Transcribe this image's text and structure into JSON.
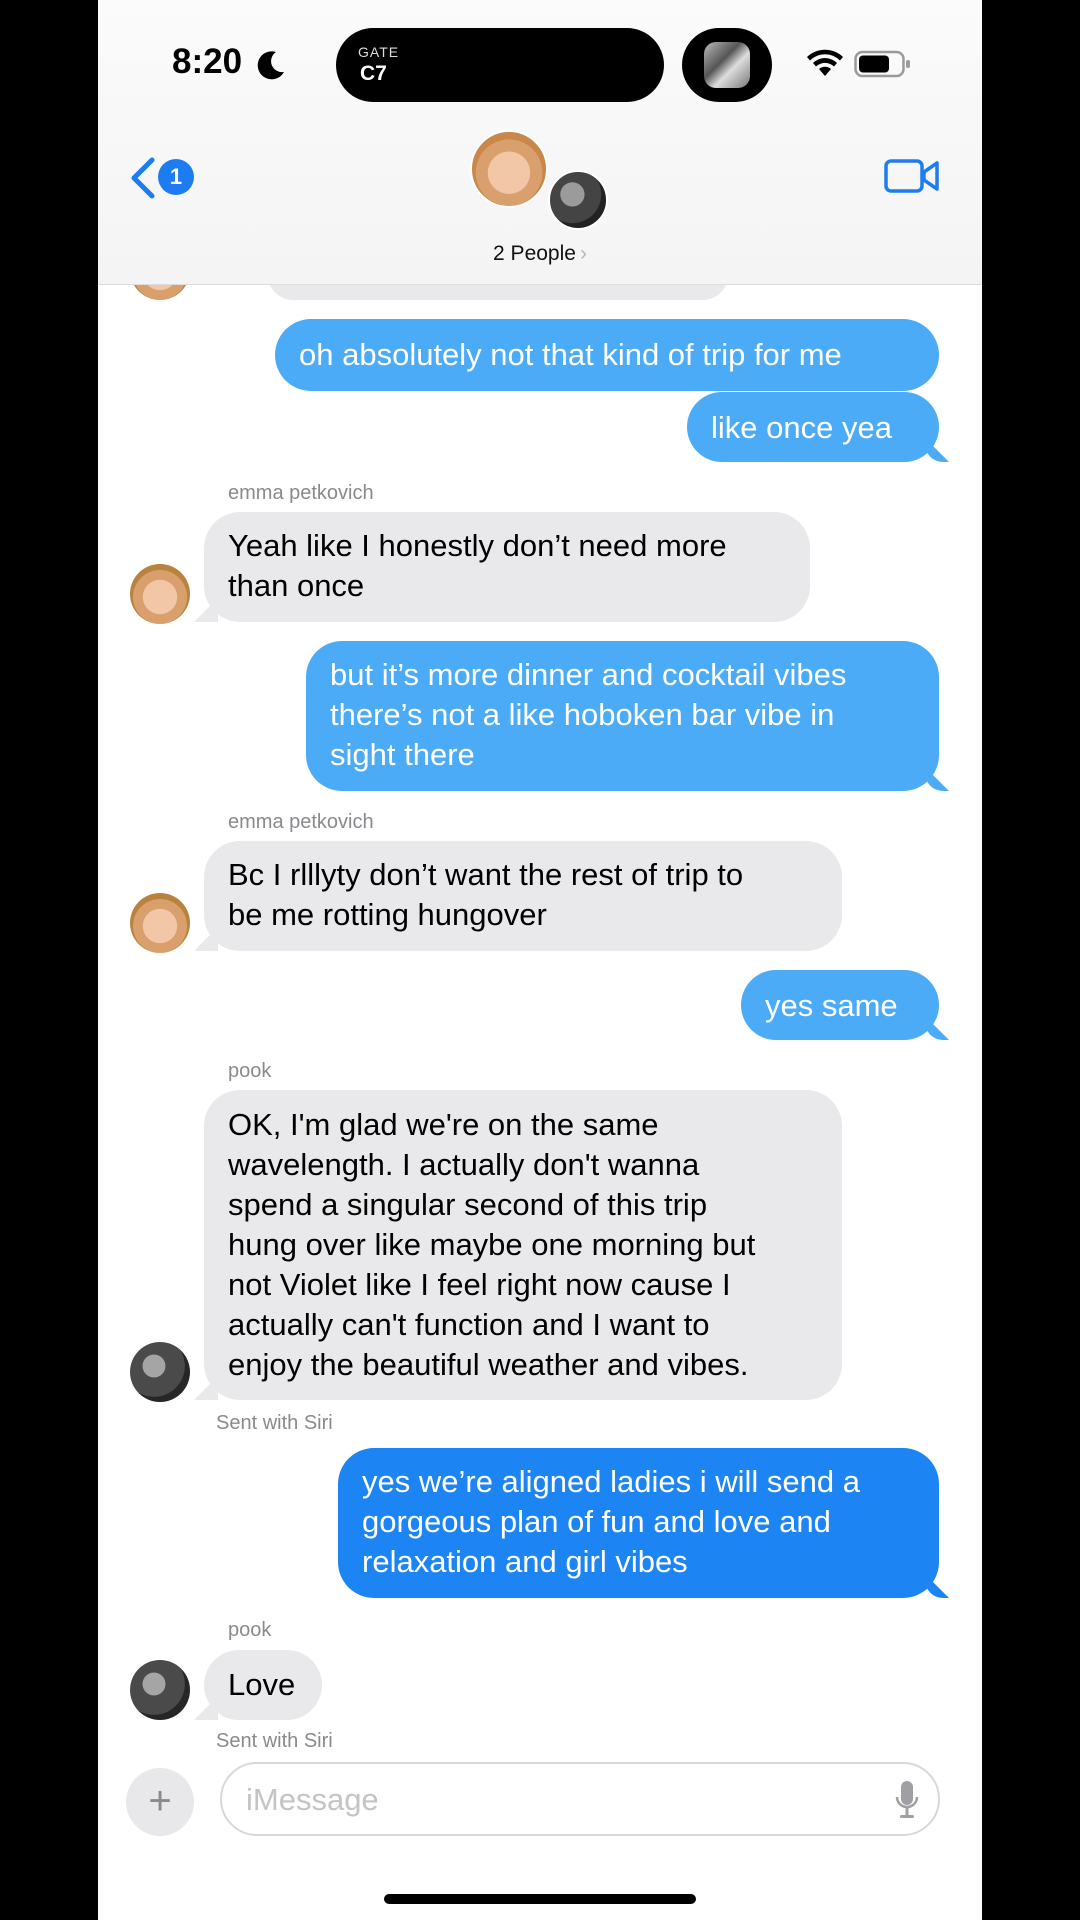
{
  "status_bar": {
    "time": "8:20",
    "live_activity_label": "GATE",
    "live_activity_value": "C7"
  },
  "header": {
    "back_badge": "1",
    "people_label": "2 People",
    "chevron": "›"
  },
  "colors": {
    "sent_bubble": "#4cabf6",
    "sent_bubble_latest": "#1d84f4",
    "received_bubble": "#e9e9eb",
    "accent": "#1e7cf2"
  },
  "messages": [
    {
      "from": "me",
      "lines": [
        "oh absolutely not that kind of trip for me"
      ]
    },
    {
      "from": "me",
      "lines": [
        "like once yea"
      ]
    },
    {
      "from": "emma petkovich",
      "sender_label": "emma petkovich",
      "lines": [
        "Yeah like I honestly don’t need more",
        "than once"
      ]
    },
    {
      "from": "me",
      "lines": [
        "but it’s more dinner and cocktail vibes",
        "there’s not a like hoboken bar vibe in",
        "sight there"
      ]
    },
    {
      "from": "emma petkovich",
      "sender_label": "emma petkovich",
      "lines": [
        "Bc I rlllyty don’t want the rest of trip to",
        "be me rotting hungover"
      ]
    },
    {
      "from": "me",
      "lines": [
        "yes same"
      ]
    },
    {
      "from": "pook",
      "sender_label": "pook",
      "lines": [
        "OK, I'm glad we're on the same",
        "wavelength. I actually don't wanna",
        "spend a singular second of this trip",
        "hung over like maybe one morning but",
        "not Violet like I feel right now cause I",
        "actually can't function and I want to",
        "enjoy the beautiful weather and vibes."
      ],
      "footnote": "Sent with Siri"
    },
    {
      "from": "me",
      "lines": [
        "yes we’re aligned ladies i will send a",
        "gorgeous plan of fun and love and",
        "relaxation and girl vibes"
      ]
    },
    {
      "from": "pook",
      "sender_label": "pook",
      "lines": [
        "Love"
      ],
      "footnote": "Sent with Siri"
    }
  ],
  "input": {
    "plus": "+",
    "placeholder": "iMessage"
  },
  "icons": [
    "moon-icon",
    "wifi-icon",
    "battery-icon",
    "back-chevron-icon",
    "video-camera-icon",
    "mic-icon",
    "plus-icon"
  ]
}
